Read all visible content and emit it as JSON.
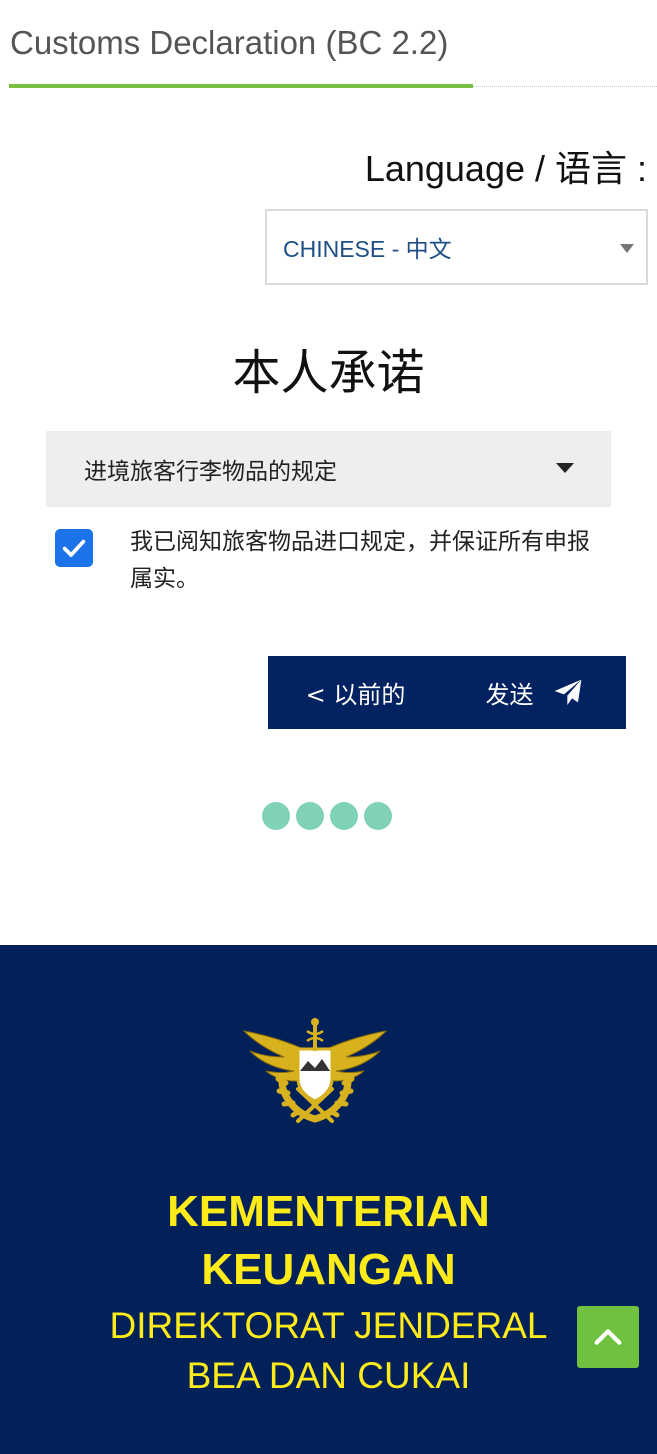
{
  "header": {
    "title": "Customs Declaration (BC 2.2)"
  },
  "language": {
    "label": "Language / 语言 :",
    "selected": "CHINESE - 中文"
  },
  "page": {
    "title": "本人承诺"
  },
  "accordion": {
    "label": "进境旅客行李物品的规定"
  },
  "agreement": {
    "checked": true,
    "text": "我已阅知旅客物品进口规定，并保证所有申报属实。"
  },
  "nav": {
    "prev_label": "< 以前的",
    "send_label": "发送"
  },
  "progress": {
    "steps": 4
  },
  "footer": {
    "line1": "KEMENTERIAN",
    "line2": "KEUANGAN",
    "line3": "DIREKTORAT JENDERAL",
    "line4": "BEA DAN CUKAI"
  },
  "colors": {
    "accent_green": "#7ac143",
    "navy": "#032261",
    "footer_navy": "#032159",
    "checkbox_blue": "#1a73e8",
    "dot_teal": "#7fd2b3",
    "footer_yellow": "#ffeb1a"
  },
  "icons": {
    "select_caret": "caret-down-icon",
    "accordion_caret": "caret-down-icon",
    "checkbox": "checkmark-icon",
    "send": "paper-plane-icon",
    "scroll_top": "chevron-up-icon",
    "logo": "customs-emblem-icon"
  }
}
